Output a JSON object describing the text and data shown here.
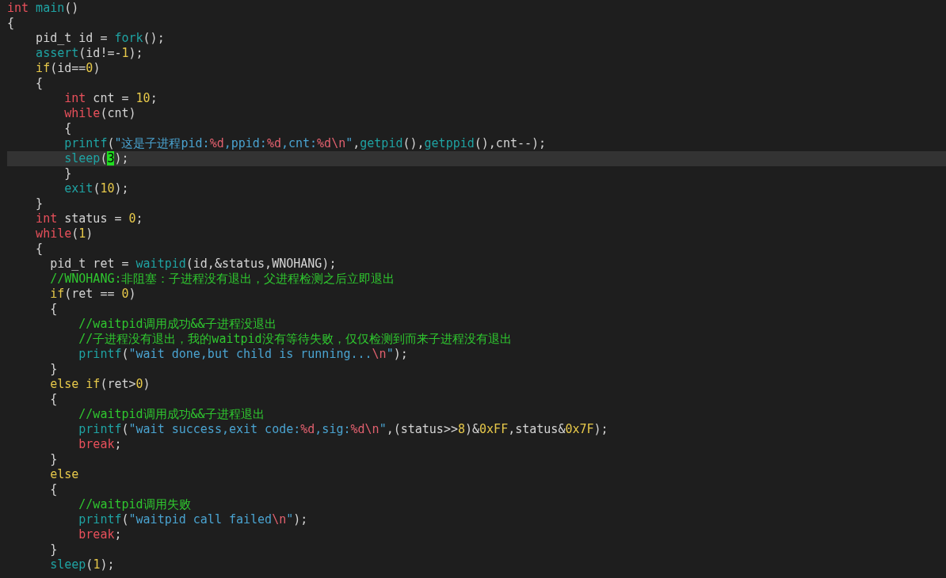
{
  "lines": [
    {
      "current": false,
      "tokens": [
        {
          "kind": "keyword",
          "text": "int"
        },
        {
          "kind": "function",
          "text": " main"
        },
        {
          "kind": "plain",
          "text": "()"
        }
      ]
    },
    {
      "current": false,
      "tokens": [
        {
          "kind": "plain",
          "text": "{"
        }
      ]
    },
    {
      "current": false,
      "tokens": [
        {
          "kind": "plain",
          "text": "    pid_t id = "
        },
        {
          "kind": "function",
          "text": "fork"
        },
        {
          "kind": "plain",
          "text": "();"
        }
      ]
    },
    {
      "current": false,
      "tokens": [
        {
          "kind": "function",
          "text": "    assert"
        },
        {
          "kind": "plain",
          "text": "(id!=-"
        },
        {
          "kind": "number",
          "text": "1"
        },
        {
          "kind": "plain",
          "text": ");"
        }
      ]
    },
    {
      "current": false,
      "tokens": [
        {
          "kind": "conditional",
          "text": "    if"
        },
        {
          "kind": "plain",
          "text": "(id=="
        },
        {
          "kind": "number",
          "text": "0"
        },
        {
          "kind": "plain",
          "text": ")"
        }
      ]
    },
    {
      "current": false,
      "tokens": [
        {
          "kind": "plain",
          "text": "    {"
        }
      ]
    },
    {
      "current": false,
      "tokens": [
        {
          "kind": "keyword",
          "text": "        int"
        },
        {
          "kind": "plain",
          "text": " cnt = "
        },
        {
          "kind": "number",
          "text": "10"
        },
        {
          "kind": "plain",
          "text": ";"
        }
      ]
    },
    {
      "current": false,
      "tokens": [
        {
          "kind": "keyword",
          "text": "        while"
        },
        {
          "kind": "plain",
          "text": "(cnt)"
        }
      ]
    },
    {
      "current": false,
      "tokens": [
        {
          "kind": "plain",
          "text": "        {"
        }
      ]
    },
    {
      "current": false,
      "tokens": [
        {
          "kind": "function",
          "text": "        printf"
        },
        {
          "kind": "plain",
          "text": "("
        },
        {
          "kind": "string",
          "text": "\"这是子进程pid:"
        },
        {
          "kind": "special",
          "text": "%d"
        },
        {
          "kind": "string",
          "text": ",ppid:"
        },
        {
          "kind": "special",
          "text": "%d"
        },
        {
          "kind": "string",
          "text": ",cnt:"
        },
        {
          "kind": "special",
          "text": "%d\\n"
        },
        {
          "kind": "string",
          "text": "\""
        },
        {
          "kind": "plain",
          "text": ","
        },
        {
          "kind": "function",
          "text": "getpid"
        },
        {
          "kind": "plain",
          "text": "(),"
        },
        {
          "kind": "function",
          "text": "getppid"
        },
        {
          "kind": "plain",
          "text": "(),cnt--);"
        }
      ]
    },
    {
      "current": true,
      "tokens": [
        {
          "kind": "function",
          "text": "        sleep"
        },
        {
          "kind": "plain",
          "text": "("
        },
        {
          "kind": "cursor",
          "text": "3"
        },
        {
          "kind": "plain",
          "text": ");"
        }
      ]
    },
    {
      "current": false,
      "tokens": [
        {
          "kind": "plain",
          "text": "        }"
        }
      ]
    },
    {
      "current": false,
      "tokens": [
        {
          "kind": "function",
          "text": "        exit"
        },
        {
          "kind": "plain",
          "text": "("
        },
        {
          "kind": "number",
          "text": "10"
        },
        {
          "kind": "plain",
          "text": ");"
        }
      ]
    },
    {
      "current": false,
      "tokens": [
        {
          "kind": "plain",
          "text": "    }"
        }
      ]
    },
    {
      "current": false,
      "tokens": [
        {
          "kind": "keyword",
          "text": "    int"
        },
        {
          "kind": "plain",
          "text": " status = "
        },
        {
          "kind": "number",
          "text": "0"
        },
        {
          "kind": "plain",
          "text": ";"
        }
      ]
    },
    {
      "current": false,
      "tokens": [
        {
          "kind": "keyword",
          "text": "    while"
        },
        {
          "kind": "plain",
          "text": "("
        },
        {
          "kind": "number",
          "text": "1"
        },
        {
          "kind": "plain",
          "text": ")"
        }
      ]
    },
    {
      "current": false,
      "tokens": [
        {
          "kind": "plain",
          "text": "    {"
        }
      ]
    },
    {
      "current": false,
      "tokens": [
        {
          "kind": "plain",
          "text": "      pid_t ret = "
        },
        {
          "kind": "function",
          "text": "waitpid"
        },
        {
          "kind": "plain",
          "text": "(id,&status,WNOHANG);"
        }
      ]
    },
    {
      "current": false,
      "tokens": [
        {
          "kind": "comment",
          "text": "      //WNOHANG:非阻塞：子进程没有退出，父进程检测之后立即退出"
        }
      ]
    },
    {
      "current": false,
      "tokens": [
        {
          "kind": "conditional",
          "text": "      if"
        },
        {
          "kind": "plain",
          "text": "(ret == "
        },
        {
          "kind": "number",
          "text": "0"
        },
        {
          "kind": "plain",
          "text": ")"
        }
      ]
    },
    {
      "current": false,
      "tokens": [
        {
          "kind": "plain",
          "text": "      {"
        }
      ]
    },
    {
      "current": false,
      "tokens": [
        {
          "kind": "comment",
          "text": "          //waitpid调用成功&&子进程没退出"
        }
      ]
    },
    {
      "current": false,
      "tokens": [
        {
          "kind": "comment",
          "text": "          //子进程没有退出，我的waitpid没有等待失败，仅仅检测到而来子进程没有退出"
        }
      ]
    },
    {
      "current": false,
      "tokens": [
        {
          "kind": "function",
          "text": "          printf"
        },
        {
          "kind": "plain",
          "text": "("
        },
        {
          "kind": "string",
          "text": "\"wait done,but child is running..."
        },
        {
          "kind": "special",
          "text": "\\n"
        },
        {
          "kind": "string",
          "text": "\""
        },
        {
          "kind": "plain",
          "text": ");"
        }
      ]
    },
    {
      "current": false,
      "tokens": [
        {
          "kind": "plain",
          "text": "      }"
        }
      ]
    },
    {
      "current": false,
      "tokens": [
        {
          "kind": "conditional",
          "text": "      else if"
        },
        {
          "kind": "plain",
          "text": "(ret>"
        },
        {
          "kind": "number",
          "text": "0"
        },
        {
          "kind": "plain",
          "text": ")"
        }
      ]
    },
    {
      "current": false,
      "tokens": [
        {
          "kind": "plain",
          "text": "      {"
        }
      ]
    },
    {
      "current": false,
      "tokens": [
        {
          "kind": "comment",
          "text": "          //waitpid调用成功&&子进程退出"
        }
      ]
    },
    {
      "current": false,
      "tokens": [
        {
          "kind": "function",
          "text": "          printf"
        },
        {
          "kind": "plain",
          "text": "("
        },
        {
          "kind": "string",
          "text": "\"wait success,exit code:"
        },
        {
          "kind": "special",
          "text": "%d"
        },
        {
          "kind": "string",
          "text": ",sig:"
        },
        {
          "kind": "special",
          "text": "%d\\n"
        },
        {
          "kind": "string",
          "text": "\""
        },
        {
          "kind": "plain",
          "text": ",(status>>"
        },
        {
          "kind": "number",
          "text": "8"
        },
        {
          "kind": "plain",
          "text": ")&"
        },
        {
          "kind": "number",
          "text": "0xFF"
        },
        {
          "kind": "plain",
          "text": ",status&"
        },
        {
          "kind": "number",
          "text": "0x7F"
        },
        {
          "kind": "plain",
          "text": ");"
        }
      ]
    },
    {
      "current": false,
      "tokens": [
        {
          "kind": "keyword",
          "text": "          break"
        },
        {
          "kind": "plain",
          "text": ";"
        }
      ]
    },
    {
      "current": false,
      "tokens": [
        {
          "kind": "plain",
          "text": "      }"
        }
      ]
    },
    {
      "current": false,
      "tokens": [
        {
          "kind": "conditional",
          "text": "      else"
        }
      ]
    },
    {
      "current": false,
      "tokens": [
        {
          "kind": "plain",
          "text": "      {"
        }
      ]
    },
    {
      "current": false,
      "tokens": [
        {
          "kind": "comment",
          "text": "          //waitpid调用失败"
        }
      ]
    },
    {
      "current": false,
      "tokens": [
        {
          "kind": "function",
          "text": "          printf"
        },
        {
          "kind": "plain",
          "text": "("
        },
        {
          "kind": "string",
          "text": "\"waitpid call failed"
        },
        {
          "kind": "special",
          "text": "\\n"
        },
        {
          "kind": "string",
          "text": "\""
        },
        {
          "kind": "plain",
          "text": ");"
        }
      ]
    },
    {
      "current": false,
      "tokens": [
        {
          "kind": "keyword",
          "text": "          break"
        },
        {
          "kind": "plain",
          "text": ";"
        }
      ]
    },
    {
      "current": false,
      "tokens": [
        {
          "kind": "plain",
          "text": "      }"
        }
      ]
    },
    {
      "current": false,
      "tokens": [
        {
          "kind": "function",
          "text": "      sleep"
        },
        {
          "kind": "plain",
          "text": "("
        },
        {
          "kind": "number",
          "text": "1"
        },
        {
          "kind": "plain",
          "text": ");"
        }
      ]
    }
  ]
}
